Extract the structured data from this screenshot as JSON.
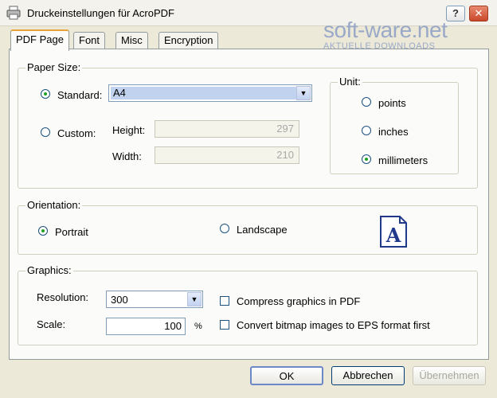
{
  "window": {
    "title": "Druckeinstellungen für AcroPDF",
    "help": "?",
    "close": "✕"
  },
  "watermark": {
    "brand": "soft-ware.net",
    "tagline": "AKTUELLE DOWNLOADS"
  },
  "tabs": [
    {
      "label": "PDF Page",
      "active": true
    },
    {
      "label": "Font"
    },
    {
      "label": "Misc"
    },
    {
      "label": "Encryption"
    }
  ],
  "paper_size": {
    "title": "Paper Size:",
    "standard_label": "Standard:",
    "standard_value": "A4",
    "custom_label": "Custom:",
    "height_label": "Height:",
    "height_value": "297",
    "width_label": "Width:",
    "width_value": "210",
    "selected": "standard"
  },
  "unit": {
    "title": "Unit:",
    "options": [
      "points",
      "inches",
      "millimeters"
    ],
    "selected": "millimeters"
  },
  "orientation": {
    "title": "Orientation:",
    "portrait_label": "Portrait",
    "landscape_label": "Landscape",
    "selected": "portrait",
    "icon_letter": "A"
  },
  "graphics": {
    "title": "Graphics:",
    "resolution_label": "Resolution:",
    "resolution_value": "300",
    "scale_label": "Scale:",
    "scale_value": "100",
    "scale_unit": "%",
    "compress_label": "Compress graphics in PDF",
    "convert_label": "Convert bitmap images to EPS format first",
    "compress_checked": false,
    "convert_checked": false
  },
  "buttons": {
    "ok": "OK",
    "cancel": "Abbrechen",
    "apply": "Übernehmen"
  },
  "colors": {
    "dialog_bg": "#ece9d8",
    "panel_bg": "#fbfbf9",
    "select_highlight": "#c1d2ee",
    "radio_dot": "#21a121"
  }
}
